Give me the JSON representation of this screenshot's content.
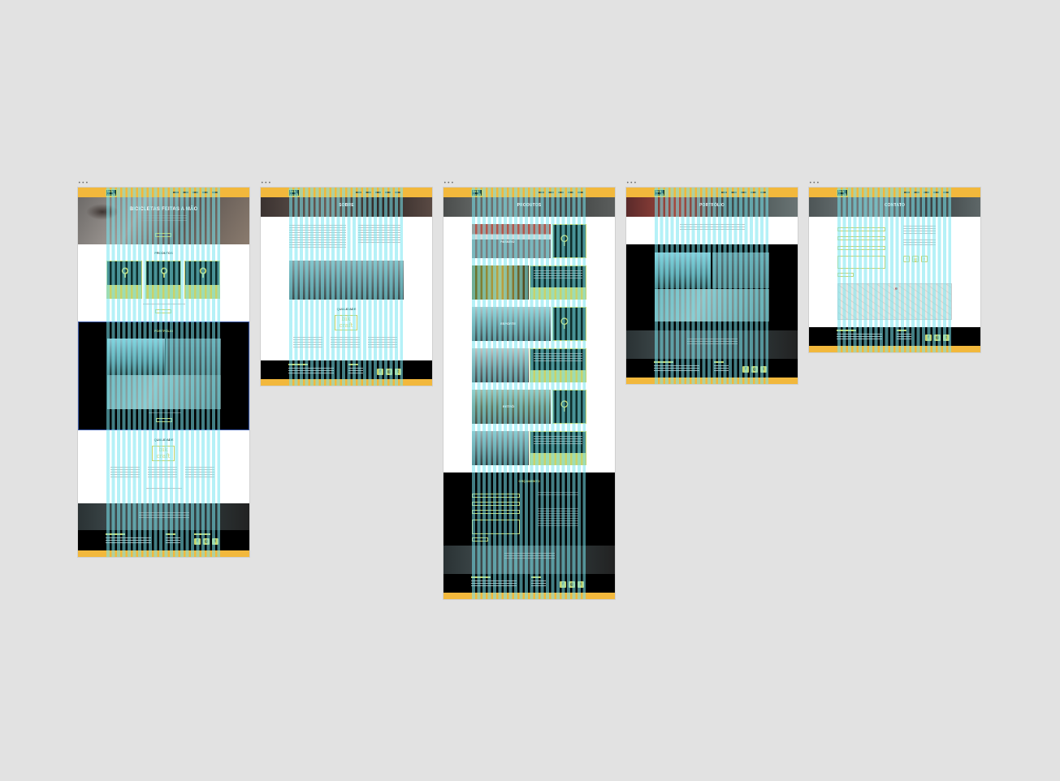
{
  "brand": {
    "logo_text": "bik craft",
    "accent": "#f2b83c",
    "dark": "#0f2e2b",
    "lime": "#c9d26a",
    "canvas_bg": "#e2e2e2"
  },
  "artboard_handle": "•••",
  "home": {
    "hero_title": "BICICLETAS FEITAS A MÃO",
    "products_title": "PRODUTOS",
    "portfolio_title": "PORTFÓLIO",
    "quality_title": "QUALIDADE",
    "quality_logo": "bik craft"
  },
  "about": {
    "hero_title": "SOBRE",
    "quality_title": "QUALIDADE",
    "quality_logo": "bik craft"
  },
  "products": {
    "hero_title": "PRODUTOS",
    "items": [
      {
        "label": "PASSEIO",
        "icon": "bicycle-icon"
      },
      {
        "label": "ESPORTE",
        "icon": "bicycle-icon"
      },
      {
        "label": "RETRÔ",
        "icon": "penny-farthing-icon"
      }
    ],
    "quote_title": "ORÇAMENTO"
  },
  "portfolio": {
    "hero_title": "PORTFÓLIO"
  },
  "contact": {
    "hero_title": "CONTATO"
  },
  "footer": {
    "social_icons": [
      "facebook-icon",
      "instagram-icon",
      "twitter-icon"
    ]
  }
}
